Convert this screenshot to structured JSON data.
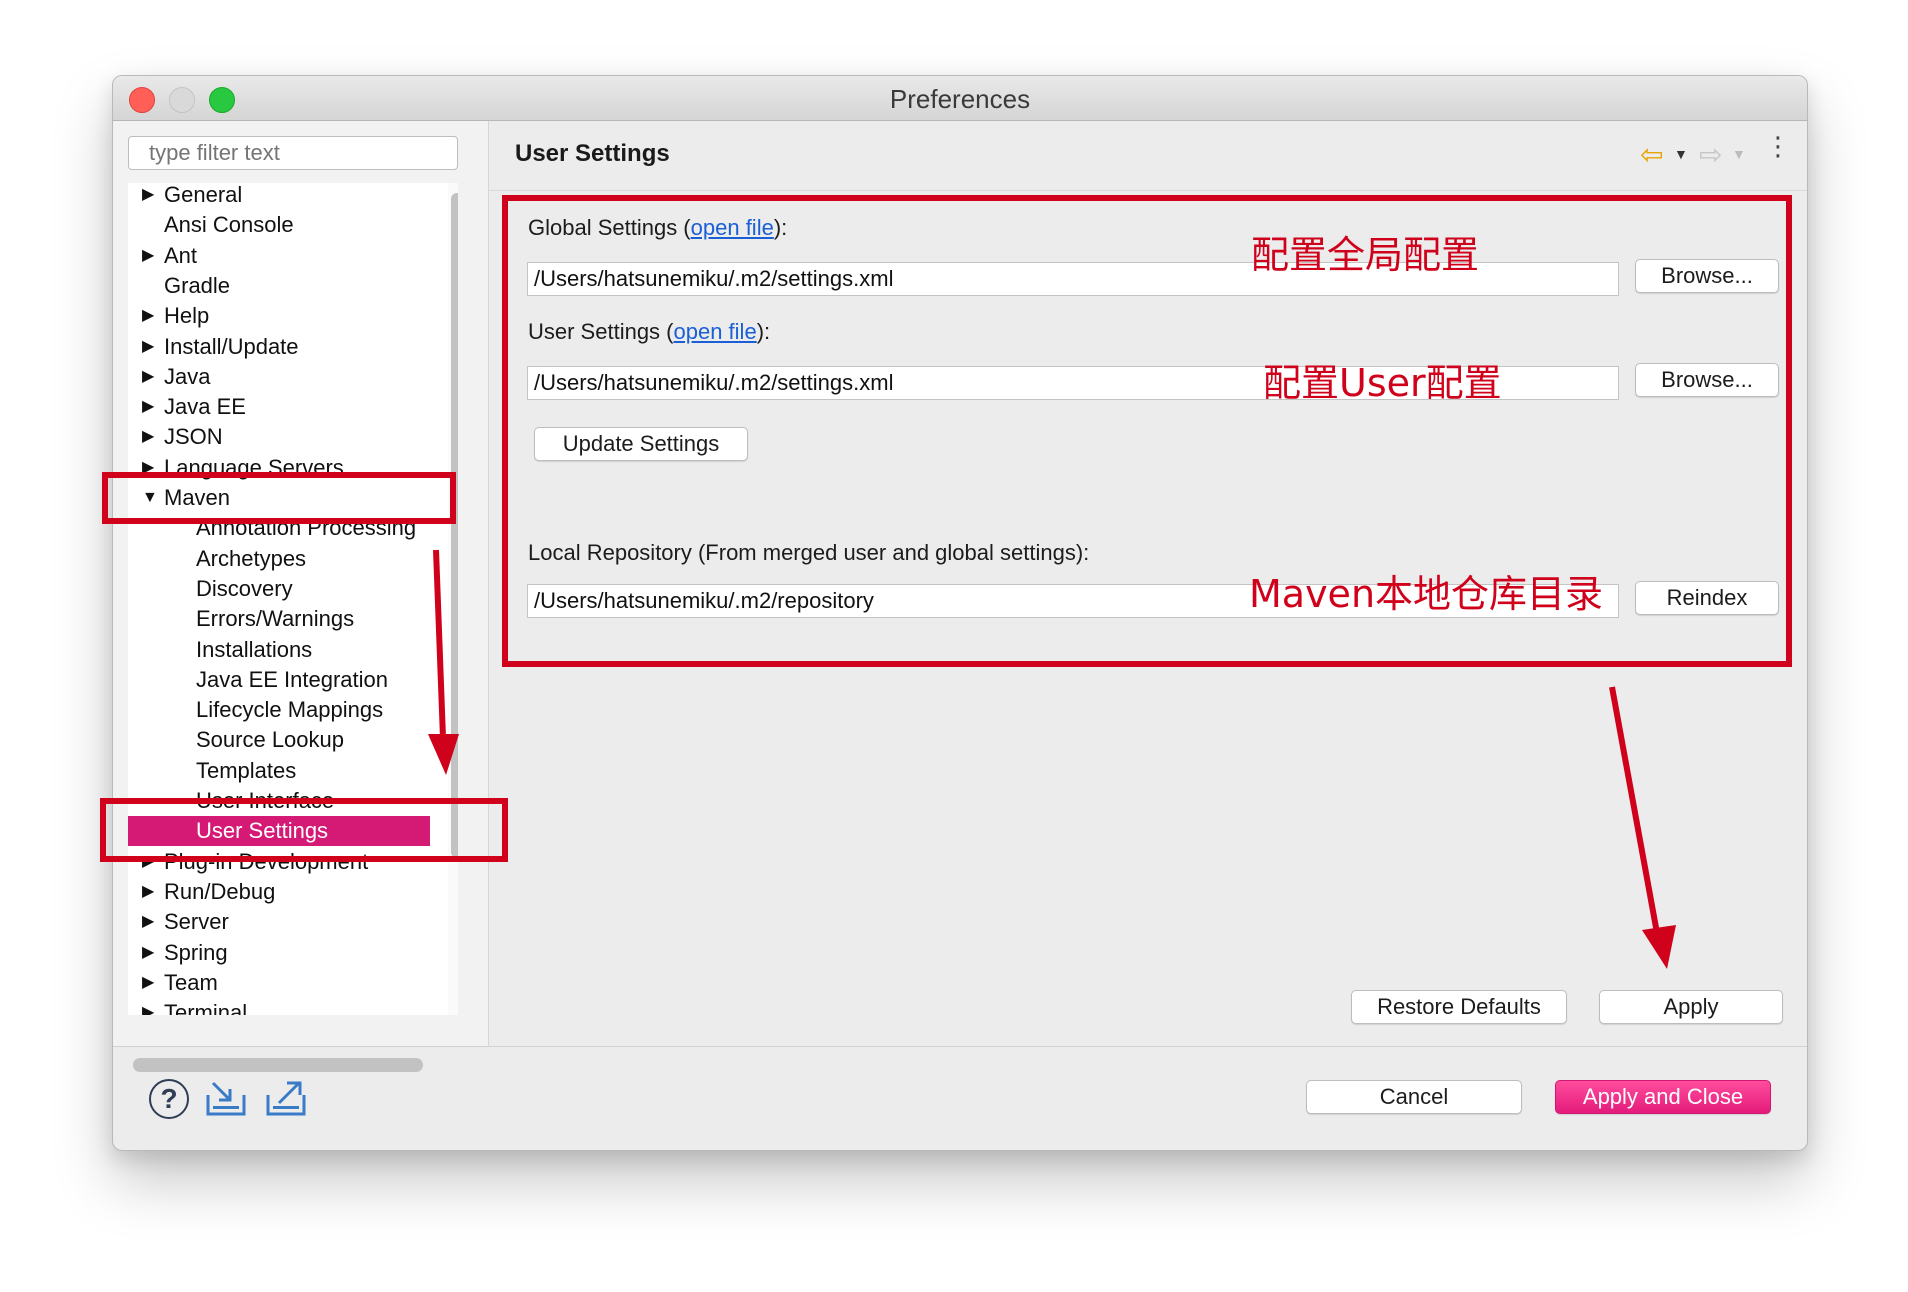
{
  "window": {
    "title": "Preferences"
  },
  "sidebar": {
    "filter_placeholder": "type filter text",
    "items": [
      {
        "label": "General",
        "expandable": true,
        "expanded": false,
        "level": 0
      },
      {
        "label": "Ansi Console",
        "expandable": false,
        "expanded": false,
        "level": 0
      },
      {
        "label": "Ant",
        "expandable": true,
        "expanded": false,
        "level": 0
      },
      {
        "label": "Gradle",
        "expandable": false,
        "expanded": false,
        "level": 0
      },
      {
        "label": "Help",
        "expandable": true,
        "expanded": false,
        "level": 0
      },
      {
        "label": "Install/Update",
        "expandable": true,
        "expanded": false,
        "level": 0
      },
      {
        "label": "Java",
        "expandable": true,
        "expanded": false,
        "level": 0
      },
      {
        "label": "Java EE",
        "expandable": true,
        "expanded": false,
        "level": 0
      },
      {
        "label": "JSON",
        "expandable": true,
        "expanded": false,
        "level": 0
      },
      {
        "label": "Language Servers",
        "expandable": true,
        "expanded": false,
        "level": 0
      },
      {
        "label": "Maven",
        "expandable": true,
        "expanded": true,
        "level": 0
      },
      {
        "label": "Annotation Processing",
        "expandable": false,
        "expanded": false,
        "level": 1
      },
      {
        "label": "Archetypes",
        "expandable": false,
        "expanded": false,
        "level": 1
      },
      {
        "label": "Discovery",
        "expandable": false,
        "expanded": false,
        "level": 1
      },
      {
        "label": "Errors/Warnings",
        "expandable": false,
        "expanded": false,
        "level": 1
      },
      {
        "label": "Installations",
        "expandable": false,
        "expanded": false,
        "level": 1
      },
      {
        "label": "Java EE Integration",
        "expandable": false,
        "expanded": false,
        "level": 1
      },
      {
        "label": "Lifecycle Mappings",
        "expandable": false,
        "expanded": false,
        "level": 1
      },
      {
        "label": "Source Lookup",
        "expandable": false,
        "expanded": false,
        "level": 1
      },
      {
        "label": "Templates",
        "expandable": false,
        "expanded": false,
        "level": 1
      },
      {
        "label": "User Interface",
        "expandable": false,
        "expanded": false,
        "level": 1
      },
      {
        "label": "User Settings",
        "expandable": false,
        "expanded": false,
        "level": 1,
        "selected": true
      },
      {
        "label": "Plug-in Development",
        "expandable": true,
        "expanded": false,
        "level": 0
      },
      {
        "label": "Run/Debug",
        "expandable": true,
        "expanded": false,
        "level": 0
      },
      {
        "label": "Server",
        "expandable": true,
        "expanded": false,
        "level": 0
      },
      {
        "label": "Spring",
        "expandable": true,
        "expanded": false,
        "level": 0
      },
      {
        "label": "Team",
        "expandable": true,
        "expanded": false,
        "level": 0
      },
      {
        "label": "Terminal",
        "expandable": true,
        "expanded": false,
        "level": 0
      }
    ]
  },
  "page": {
    "title": "User Settings",
    "global": {
      "label_prefix": "Global Settings (",
      "link": "open file",
      "label_suffix": "):",
      "value": "/Users/hatsunemiku/.m2/settings.xml",
      "browse": "Browse..."
    },
    "user": {
      "label_prefix": "User Settings (",
      "link": "open file",
      "label_suffix": "):",
      "value": "/Users/hatsunemiku/.m2/settings.xml",
      "browse": "Browse..."
    },
    "update_button": "Update Settings",
    "local_repo": {
      "label": "Local Repository (From merged user and global settings):",
      "value": "/Users/hatsunemiku/.m2/repository",
      "reindex": "Reindex"
    },
    "restore_defaults": "Restore Defaults",
    "apply": "Apply"
  },
  "footer": {
    "cancel": "Cancel",
    "apply_and_close": "Apply and Close"
  },
  "annotations": {
    "global_note": "配置全局配置",
    "user_note": "配置User配置",
    "repo_note": "Maven本地仓库目录",
    "color": "#d0021b"
  },
  "colors": {
    "selection": "#d51a76",
    "primary_button": "#e41b7b",
    "link": "#1a5fd6"
  }
}
